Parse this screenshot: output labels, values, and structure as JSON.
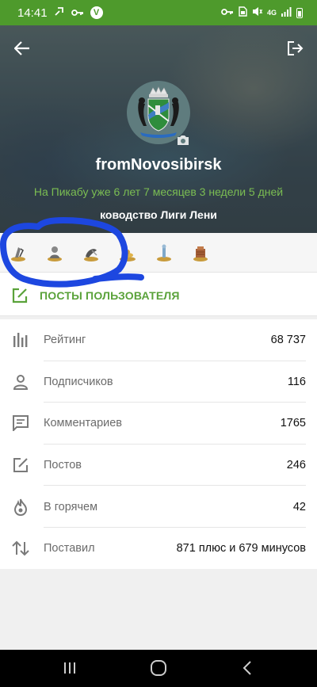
{
  "status_bar": {
    "time": "14:41",
    "left_icons": [
      "share-icon",
      "key-icon",
      "v-badge-icon"
    ],
    "right_icons": [
      "key-icon",
      "sim-icon",
      "mute-icon",
      "network-4g-icon",
      "signal-icon",
      "battery-icon"
    ],
    "network": "4G",
    "color": "#4e9a2c"
  },
  "header": {
    "back_icon": "arrow-left-icon",
    "logout_icon": "logout-icon",
    "username": "fromNovosibirsk",
    "since": "На Пикабу уже 6 лет 7 месяцев 3 недели 5 дней",
    "title": "ководство Лиги Лени",
    "accent": "#7bbd52"
  },
  "awards": [
    "award-1-icon",
    "award-2-icon",
    "award-3-icon",
    "award-4-icon",
    "award-5-icon",
    "award-6-icon"
  ],
  "posts_link": {
    "label": "ПОСТЫ ПОЛЬЗОВАТЕЛЯ",
    "icon": "edit-square-icon"
  },
  "stats": [
    {
      "icon": "bars-icon",
      "label": "Рейтинг",
      "value": "68 737"
    },
    {
      "icon": "person-icon",
      "label": "Подписчиков",
      "value": "116"
    },
    {
      "icon": "comment-icon",
      "label": "Комментариев",
      "value": "1765"
    },
    {
      "icon": "edit-icon",
      "label": "Постов",
      "value": "246"
    },
    {
      "icon": "flame-icon",
      "label": "В горячем",
      "value": "42"
    },
    {
      "icon": "sort-arrows-icon",
      "label": "Поставил",
      "value": "871 плюс и 679 минусов"
    }
  ],
  "navbar": [
    "recents-icon",
    "home-icon",
    "back-icon"
  ]
}
